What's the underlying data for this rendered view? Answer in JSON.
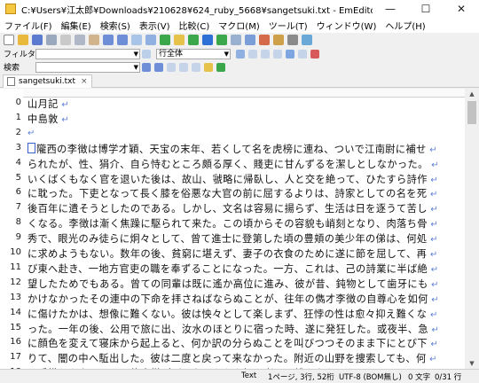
{
  "window": {
    "title": "C:¥Users¥江太郎¥Downloads¥210628¥624_ruby_5668¥sangetsuki.txt - EmEditor",
    "minimize": "—",
    "maximize": "☐",
    "close": "✕"
  },
  "menu": [
    "ファイル(F)",
    "編集(E)",
    "検索(S)",
    "表示(V)",
    "比較(C)",
    "マクロ(M)",
    "ツール(T)",
    "ウィンドウ(W)",
    "ヘルプ(H)"
  ],
  "filter_bar": {
    "label": "フィルター",
    "scope_value": "行全体"
  },
  "search_bar": {
    "label": "検索"
  },
  "tab": {
    "label": "sangetsuki.txt",
    "close": "×"
  },
  "lines": [
    {
      "num": "0",
      "text": "山月記"
    },
    {
      "num": "1",
      "text": "中島敦"
    },
    {
      "num": "2",
      "text": ""
    },
    {
      "num": "3",
      "text": "隴西の李徴は博学才穎、天宝の末年、若くして名を虎榜に連ね、ついで江南尉に補せ"
    },
    {
      "num": "4",
      "text": "られたが、性、狷介、自ら恃むところ頗る厚く、賤吏に甘んずるを潔しとしなかった。"
    },
    {
      "num": "5",
      "text": "いくばくもなく官を退いた後は、故山、虢略に帰臥し、人と交を絶って、ひたすら詩作"
    },
    {
      "num": "6",
      "text": "に耽った。下吏となって長く膝を俗悪な大官の前に屈するよりは、詩家としての名を死"
    },
    {
      "num": "7",
      "text": "後百年に遺そうとしたのである。しかし、文名は容易に揚らず、生活は日を逐うて苦し"
    },
    {
      "num": "8",
      "text": "くなる。李徴は漸く焦躁に駆られて来た。この頃からその容貌も峭刻となり、肉落ち骨"
    },
    {
      "num": "9",
      "text": "秀で、眼光のみ徒らに炯々として、曾て進士に登第した頃の豊頬の美少年の俤は、何処"
    },
    {
      "num": "10",
      "text": "に求めようもない。数年の後、貧窮に堪えず、妻子の衣食のために遂に節を屈して、再"
    },
    {
      "num": "11",
      "text": "び東へ赴き、一地方官吏の職を奉ずることになった。一方、これは、己の詩業に半ば絶"
    },
    {
      "num": "12",
      "text": "望したためでもある。曾ての同輩は既に遙か高位に進み、彼が昔、鈍物として歯牙にも"
    },
    {
      "num": "13",
      "text": "かけなかったその連中の下命を拝さねばならぬことが、往年の儁才李徴の自尊心を如何"
    },
    {
      "num": "14",
      "text": "に傷けたかは、想像に難くない。彼は怏々として楽しまず、狂悖の性は愈々抑え難くな"
    },
    {
      "num": "15",
      "text": "った。一年の後、公用で旅に出、汝水のほとりに宿った時、遂に発狂した。或夜半、急"
    },
    {
      "num": "16",
      "text": "に顔色を変えて寝床から起上ると、何か訳の分らぬことを叫びつつそのまま下にとび下"
    },
    {
      "num": "17",
      "text": "りて、闇の中へ駈出した。彼は二度と戻って来なかった。附近の山野を捜索しても、何"
    },
    {
      "num": "18",
      "text": "の手掛りもない。その後李徴がどうなったかを知る者は、誰もなかった。"
    }
  ],
  "status": {
    "mode": "Text",
    "position": "1ページ, 3行, 52桁",
    "encoding": "UTF-8 (BOM無し)",
    "count": "0 文字",
    "lines": "0/31 行"
  },
  "colors": {
    "line_number": "#1a1a1a",
    "eol_mark": "#5c7fd8",
    "cursor_mark": "#3a5fcd",
    "toolbar_green": "#3aa84a",
    "toolbar_blue": "#2e6fd6"
  }
}
